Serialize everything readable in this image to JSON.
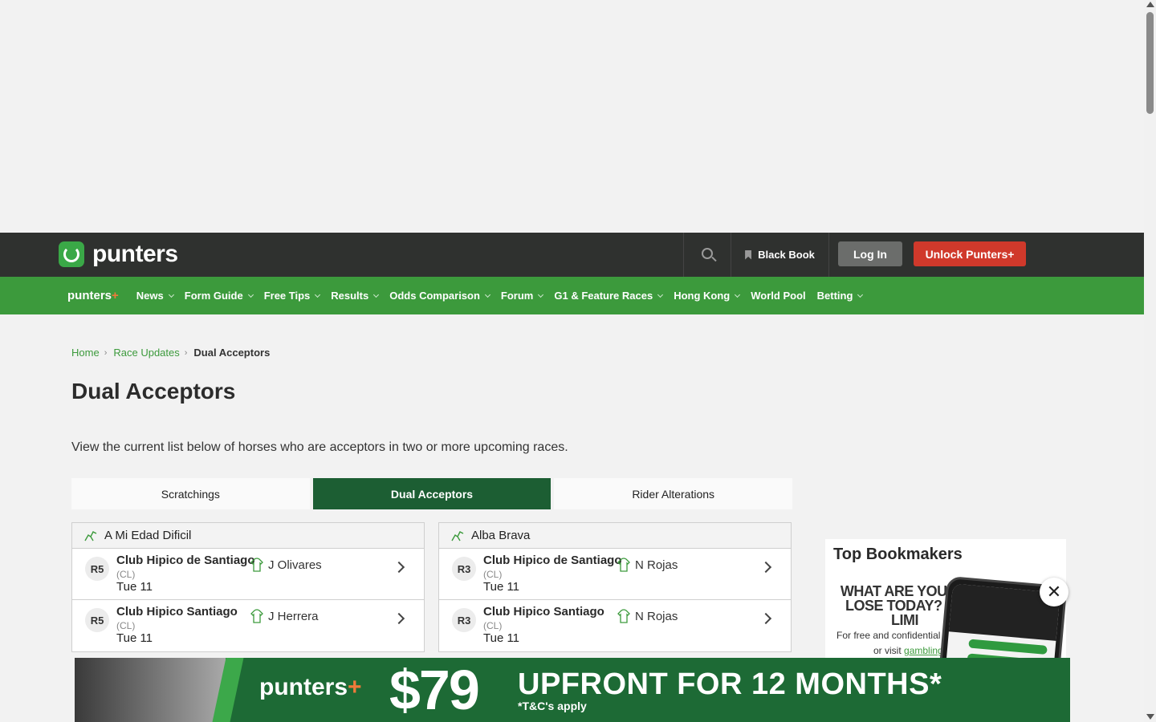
{
  "header": {
    "logo_text": "punters",
    "black_book_label": "Black Book",
    "login_label": "Log In",
    "unlock_label": "Unlock Punters+"
  },
  "nav": {
    "brand": "punters",
    "brand_plus": "+",
    "items": [
      {
        "label": "News",
        "has_dropdown": true
      },
      {
        "label": "Form Guide",
        "has_dropdown": true
      },
      {
        "label": "Free Tips",
        "has_dropdown": true
      },
      {
        "label": "Results",
        "has_dropdown": true
      },
      {
        "label": "Odds Comparison",
        "has_dropdown": true
      },
      {
        "label": "Forum",
        "has_dropdown": true
      },
      {
        "label": "G1 & Feature Races",
        "has_dropdown": true
      },
      {
        "label": "Hong Kong",
        "has_dropdown": true
      },
      {
        "label": "World Pool",
        "has_dropdown": false
      },
      {
        "label": "Betting",
        "has_dropdown": true
      }
    ]
  },
  "breadcrumb": {
    "home": "Home",
    "parent": "Race Updates",
    "current": "Dual Acceptors",
    "separator": "›"
  },
  "page": {
    "title": "Dual Acceptors",
    "intro": "View the current list below of horses who are acceptors in two or more upcoming races."
  },
  "tabs": [
    {
      "label": "Scratchings",
      "active": false
    },
    {
      "label": "Dual Acceptors",
      "active": true
    },
    {
      "label": "Rider Alterations",
      "active": false
    }
  ],
  "horses": [
    {
      "name": "A Mi Edad Dificil",
      "races": [
        {
          "race": "R5",
          "venue": "Club Hipico de Santiago",
          "country": "(CL)",
          "date": "Tue 11",
          "jockey": "J Olivares"
        },
        {
          "race": "R5",
          "venue": "Club Hipico Santiago",
          "country": "(CL)",
          "date": "Tue 11",
          "jockey": "J Herrera"
        }
      ]
    },
    {
      "name": "Alba Brava",
      "races": [
        {
          "race": "R3",
          "venue": "Club Hipico de Santiago",
          "country": "(CL)",
          "date": "Tue 11",
          "jockey": "N Rojas"
        },
        {
          "race": "R3",
          "venue": "Club Hipico Santiago",
          "country": "(CL)",
          "date": "Tue 11",
          "jockey": "N Rojas"
        }
      ]
    }
  ],
  "sidebar": {
    "title": "Top Bookmakers",
    "gamble_headline": "WHAT ARE YOU PE LOSE TODAY? SE LIMI",
    "gamble_sub": "For free and confidential su",
    "gamble_sub2_prefix": "or visit ",
    "gamble_link": "gamblingh"
  },
  "promo": {
    "brand": "punters",
    "brand_plus": "+",
    "price": "$79",
    "offer": "UPFRONT FOR 12 MONTHS*",
    "tc": "*T&C's apply"
  },
  "close_label": "✕"
}
